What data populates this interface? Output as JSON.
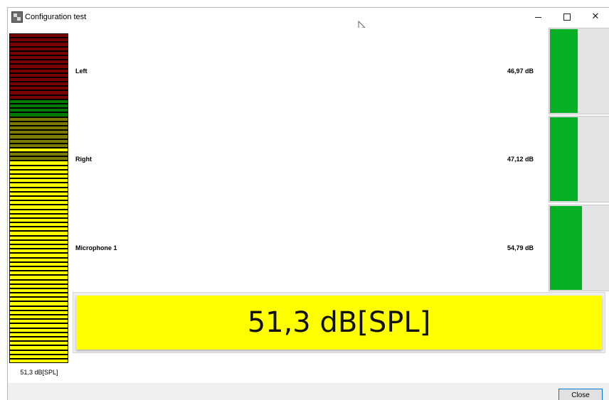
{
  "window": {
    "title": "Configuration test"
  },
  "icons": {
    "app": "app-icon",
    "minimize": "minimize-icon",
    "maximize": "maximize-icon",
    "close": "close-icon",
    "cursor": "mouse-cursor-icon"
  },
  "colors": {
    "led_red": "#7b0000",
    "led_green": "#007b00",
    "led_olive": "#7b7b00",
    "led_yellow": "#ffff00",
    "meter_green": "#06b025",
    "readout_bg": "#ffff00"
  },
  "led_meter": {
    "caption": "51,3 dB[SPL]",
    "segments": [
      "red",
      "red",
      "red",
      "red",
      "red",
      "red",
      "red",
      "red",
      "red",
      "red",
      "red",
      "red",
      "red",
      "red",
      "red",
      "green",
      "green",
      "green",
      "green",
      "olive",
      "olive",
      "olive",
      "olive",
      "olive",
      "olive",
      "olive",
      "yellow",
      "olive",
      "olive",
      "yellow",
      "yellow",
      "yellow",
      "yellow",
      "yellow",
      "yellow",
      "yellow",
      "yellow",
      "yellow",
      "yellow",
      "yellow",
      "yellow",
      "yellow",
      "yellow",
      "yellow",
      "yellow",
      "yellow",
      "yellow",
      "yellow",
      "yellow",
      "yellow",
      "yellow",
      "yellow",
      "yellow",
      "yellow",
      "yellow",
      "yellow",
      "yellow",
      "yellow",
      "yellow",
      "yellow",
      "yellow",
      "yellow",
      "yellow",
      "yellow",
      "yellow",
      "yellow",
      "yellow",
      "yellow",
      "yellow",
      "yellow",
      "yellow",
      "yellow",
      "yellow",
      "yellow",
      "yellow"
    ]
  },
  "channels": [
    {
      "name": "Left",
      "value": "46,97 dB",
      "level_fraction": 0.47
    },
    {
      "name": "Right",
      "value": "47,12 dB",
      "level_fraction": 0.47
    },
    {
      "name": "Microphone 1",
      "value": "54,79 dB",
      "level_fraction": 0.55
    }
  ],
  "readout": {
    "value": "51,3 dB[SPL]"
  },
  "buttons": {
    "close_label": "Close"
  }
}
